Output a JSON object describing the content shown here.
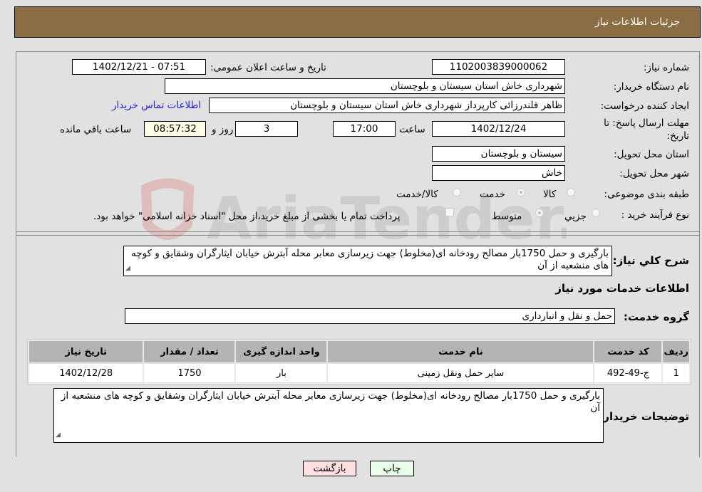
{
  "header": {
    "title": "جزئیات اطلاعات نیاز"
  },
  "form": {
    "need_number_label": "شماره نیاز:",
    "need_number": "1102003839000062",
    "announce_label": "تاریخ و ساعت اعلان عمومی:",
    "announce_value": "1402/12/21 - 07:51",
    "buyer_org_label": "نام دستگاه خریدار:",
    "buyer_org": "شهرداری خاش استان سیستان و بلوچستان",
    "creator_label": "ایجاد کننده درخواست:",
    "creator": "ظاهر قلندرزائی کارپرداز شهرداری خاش استان سیستان و بلوچستان",
    "contact_link": "اطلاعات تماس خریدار",
    "deadline_label_1": "مهلت ارسال پاسخ: تا",
    "deadline_label_2": "تاریخ:",
    "deadline_date": "1402/12/24",
    "time_label": "ساعت",
    "deadline_time": "17:00",
    "days_value": "3",
    "days_label": "روز و",
    "remaining_time": "08:57:32",
    "remaining_label": "ساعت باقي مانده",
    "province_label": "استان محل تحویل:",
    "province": "سیستان و بلوچستان",
    "city_label": "شهر محل تحویل:",
    "city": "خاش",
    "category_label": "طبقه بندی موضوعی:",
    "category_options": [
      "کالا",
      "خدمت",
      "کالا/خدمت"
    ],
    "category_selected": "خدمت",
    "process_label": "نوع فرآیند خرید :",
    "process_options": [
      "جزيي",
      "متوسط"
    ],
    "process_selected": "متوسط",
    "treasury_note": "پرداخت تمام یا بخشی از مبلغ خرید،از محل \"اسناد خزانه اسلامی\" خواهد بود.",
    "description_label": "شرح کلي نياز:",
    "description": "بارگیری و حمل 1750بار مصالح رودخانه ای(مخلوط) جهت زیرسازی معابر محله آبترش  خیابان ایثارگران وشقایق و کوچه های منشعبه از آن"
  },
  "services": {
    "section_title": "اطلاعات خدمات مورد نیاز",
    "group_label": "گروه خدمت:",
    "group_value": "حمل و نقل و انبارداری",
    "columns": [
      "ردیف",
      "کد خدمت",
      "نام خدمت",
      "واحد اندازه گیری",
      "تعداد / مقدار",
      "تاریخ نیاز"
    ],
    "rows": [
      [
        "1",
        "ج-49-492",
        "سایر حمل ونقل زمینی",
        "بار",
        "1750",
        "1402/12/28"
      ]
    ]
  },
  "buyer_notes": {
    "label": "توضیحات خریدار:",
    "text": "بارگیری و حمل 1750بار مصالح رودخانه ای(مخلوط) جهت زیرسازی معابر محله آبترش  خیابان ایثارگران وشقایق و کوچه های منشعبه از آن"
  },
  "buttons": {
    "print": "چاپ",
    "back": "بازگشت"
  },
  "watermark": {
    "text": "AriaTender.neT"
  },
  "colors": {
    "header_bg": "#8b6d43",
    "print_bg": "#eaffea",
    "back_bg": "#ffe0e0",
    "link": "#2222cc"
  }
}
